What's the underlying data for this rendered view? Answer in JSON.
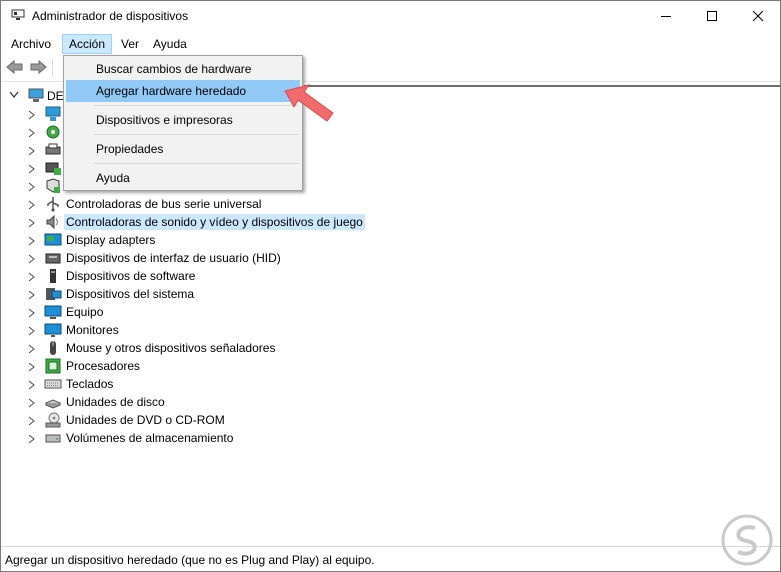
{
  "window": {
    "title": "Administrador de dispositivos"
  },
  "menubar": {
    "items": [
      "Archivo",
      "Acción",
      "Ver",
      "Ayuda"
    ]
  },
  "dropdown": {
    "items": [
      "Buscar cambios de hardware",
      "Agregar hardware heredado",
      "Dispositivos e impresoras",
      "Propiedades",
      "Ayuda"
    ]
  },
  "tree": {
    "root_label": "DE",
    "items": [
      {
        "label": "",
        "icon": "network-icon"
      },
      {
        "label": "",
        "icon": "audio-io-icon"
      },
      {
        "label": "",
        "icon": "printer-icon"
      },
      {
        "label": "",
        "icon": "print-queue-icon"
      },
      {
        "label": "",
        "icon": "usb-device-icon"
      },
      {
        "label": "Controladoras de bus serie universal",
        "icon": "usb-controller-icon"
      },
      {
        "label": "Controladoras de sonido y vídeo y dispositivos de juego",
        "icon": "speaker-icon",
        "selected": true
      },
      {
        "label": "Display adapters",
        "icon": "display-adapter-icon"
      },
      {
        "label": "Dispositivos de interfaz de usuario (HID)",
        "icon": "hid-icon"
      },
      {
        "label": "Dispositivos de software",
        "icon": "software-device-icon"
      },
      {
        "label": "Dispositivos del sistema",
        "icon": "system-device-icon"
      },
      {
        "label": "Equipo",
        "icon": "computer-icon"
      },
      {
        "label": "Monitores",
        "icon": "monitor-icon"
      },
      {
        "label": "Mouse y otros dispositivos señaladores",
        "icon": "mouse-icon"
      },
      {
        "label": "Procesadores",
        "icon": "processor-icon"
      },
      {
        "label": "Teclados",
        "icon": "keyboard-icon"
      },
      {
        "label": "Unidades de disco",
        "icon": "disk-drive-icon"
      },
      {
        "label": "Unidades de DVD o CD-ROM",
        "icon": "dvd-drive-icon"
      },
      {
        "label": "Volúmenes de almacenamiento",
        "icon": "storage-volume-icon"
      }
    ]
  },
  "status": {
    "text": "Agregar un dispositivo heredado (que no es Plug and Play) al equipo."
  },
  "colors": {
    "accent": "#cce8ff",
    "menu_highlight": "#91c9f7",
    "arrow": "#f26b6b"
  }
}
